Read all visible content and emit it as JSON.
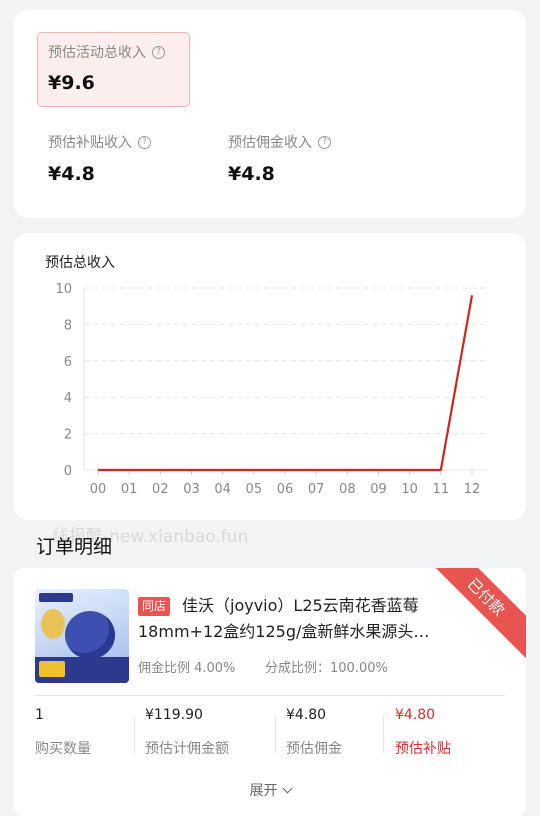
{
  "summary": {
    "total_label": "预估活动总收入",
    "total_value": "¥9.6",
    "subsidy_label": "预估补贴收入",
    "subsidy_value": "¥4.8",
    "commission_label": "预估佣金收入",
    "commission_value": "¥4.8",
    "help_glyph": "?"
  },
  "chart_data": {
    "type": "line",
    "title": "预估总收入",
    "x": [
      "00",
      "01",
      "02",
      "03",
      "04",
      "05",
      "06",
      "07",
      "08",
      "09",
      "10",
      "11",
      "12"
    ],
    "series": [
      {
        "values": [
          0,
          0,
          0,
          0,
          0,
          0,
          0,
          0,
          0,
          0,
          0,
          0,
          9.6
        ],
        "color": "#c8281e"
      }
    ],
    "ylim": [
      0,
      10
    ],
    "yticks": [
      "0",
      "2",
      "4",
      "6",
      "8",
      "10"
    ],
    "grid": true
  },
  "watermark": "线报酷-new.xianbao.fun",
  "orders": {
    "section_title": "订单明细",
    "item": {
      "shop_tag": "同店",
      "title": "佳沃（joyvio）L25云南花香蓝莓18mm+12盒约125g/盒新鲜水果源头…",
      "commission_rate": "佣金比例 4.00%",
      "share_rate": "分成比例：100.00%",
      "status": "已付款",
      "columns": [
        {
          "value": "1",
          "label": "购买数量"
        },
        {
          "value": "¥119.90",
          "label": "预估计佣金额"
        },
        {
          "value": "¥4.80",
          "label": "预估佣金"
        },
        {
          "value": "¥4.80",
          "label": "预估补贴"
        }
      ],
      "expand_label": "展开"
    }
  }
}
